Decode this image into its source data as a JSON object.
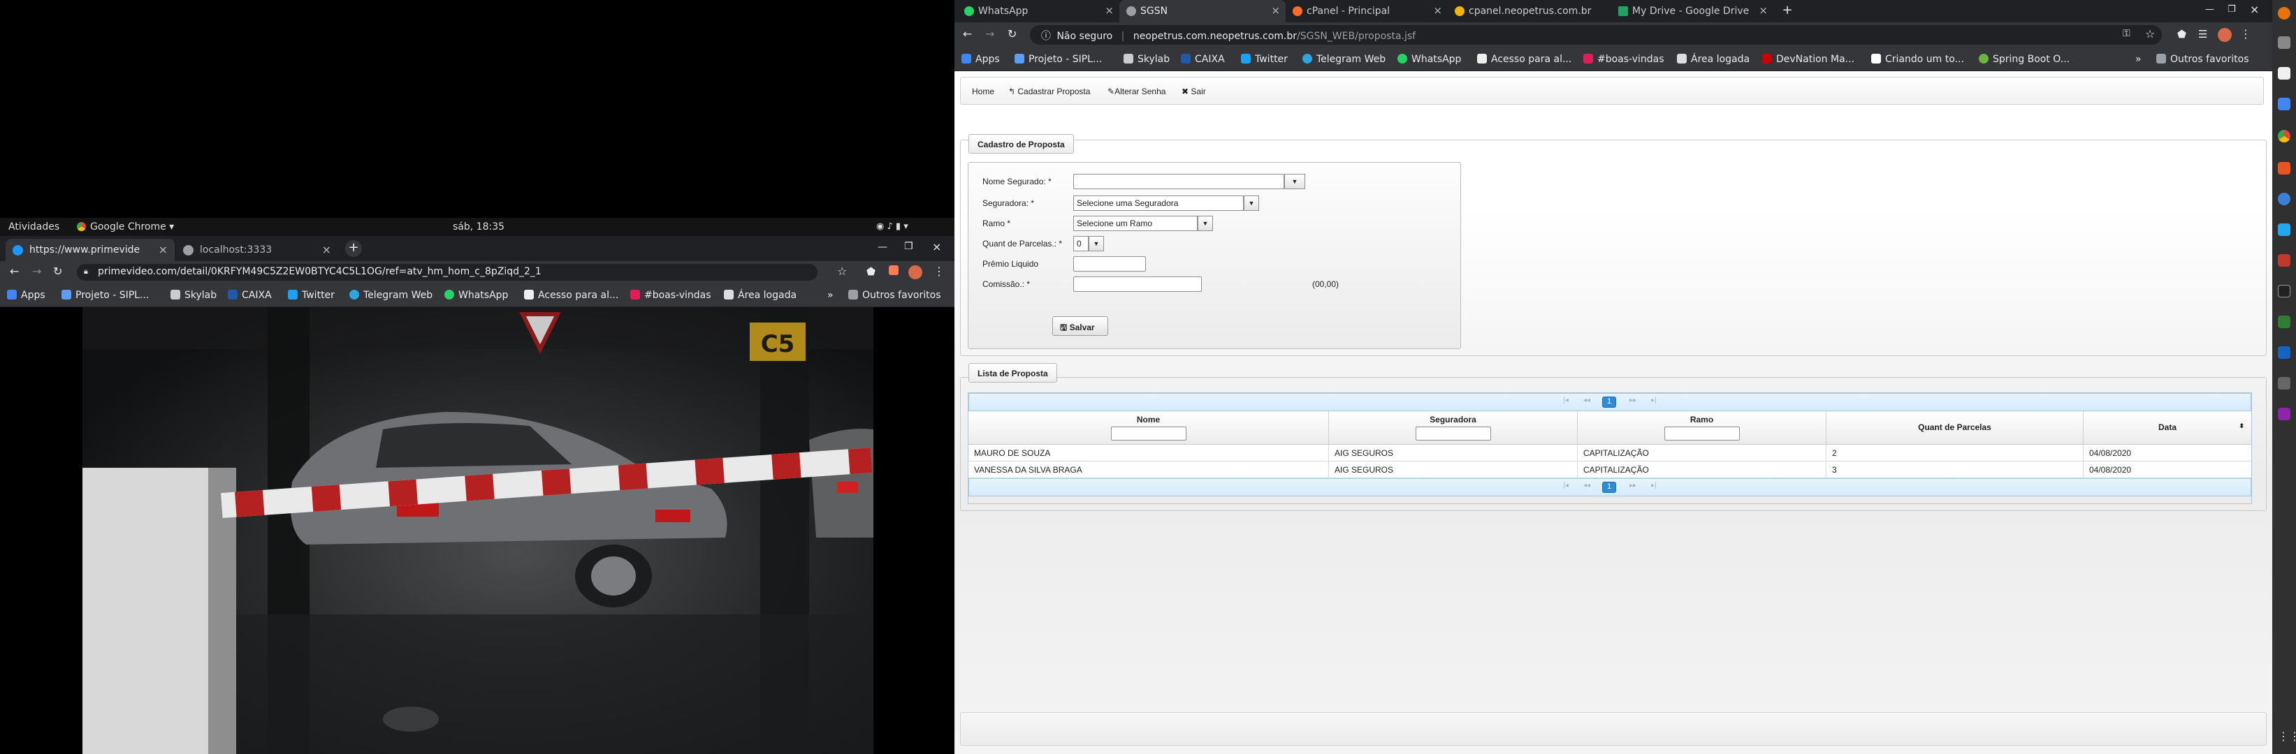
{
  "left_window": {
    "gnome": {
      "activities": "Atividades",
      "app": "Google Chrome",
      "clock": "sáb, 18:35"
    },
    "tabs": [
      {
        "label": "https://www.primevide",
        "active": true
      },
      {
        "label": "localhost:3333",
        "active": false
      }
    ],
    "url": "primevideo.com/detail/0KRFYM49C5Z2EW0BTYC4C5L1OG/ref=atv_hm_hom_c_8pZiqd_2_1",
    "bookmarks": [
      "Apps",
      "Projeto - SIPL...",
      "Skylab",
      "CAIXA",
      "Twitter",
      "Telegram Web",
      "WhatsApp",
      "Acesso para al...",
      "#boas-vindas",
      "Área logada"
    ],
    "other_bookmarks": "Outros favoritos",
    "video_sign": "C5"
  },
  "right_window": {
    "tabs": [
      {
        "label": "WhatsApp",
        "active": false,
        "color": "#25d366"
      },
      {
        "label": "SGSN",
        "active": true,
        "color": "#9aa0a6"
      },
      {
        "label": "cPanel - Principal",
        "active": false,
        "color": "#ff6c2c"
      },
      {
        "label": "cpanel.neopetrus.com.br",
        "active": false,
        "color": "#f4b400"
      },
      {
        "label": "My Drive - Google Drive",
        "active": false,
        "color": "#1fa463"
      }
    ],
    "security": "Não seguro",
    "url_domain": "neopetrus.com.neopetrus.com.br",
    "url_path": "/SGSN_WEB/proposta.jsf",
    "bookmarks": [
      "Apps",
      "Projeto - SIPL...",
      "Skylab",
      "CAIXA",
      "Twitter",
      "Telegram Web",
      "WhatsApp",
      "Acesso para al...",
      "#boas-vindas",
      "Área logada",
      "DevNation Ma...",
      "Criando um to...",
      "Spring Boot O..."
    ],
    "other_bookmarks": "Outros favoritos"
  },
  "page": {
    "menu": {
      "home": "Home",
      "cadastrar": "Cadastrar Proposta",
      "alterar": "Alterar Senha",
      "sair": "Sair"
    },
    "form": {
      "legend": "Cadastro de Proposta",
      "nome_label": "Nome Segurado: *",
      "seguradora_label": "Seguradora: *",
      "seguradora_value": "Selecione uma Seguradora",
      "ramo_label": "Ramo *",
      "ramo_value": "Selecione um Ramo",
      "parcelas_label": "Quant de Parcelas.: *",
      "parcelas_value": "0",
      "premio_label": "Prêmio Liquido",
      "comissao_label": "Comissão.: *",
      "comissao_hint": "(00,00)",
      "save_label": "Salvar"
    },
    "list": {
      "legend": "Lista de Proposta",
      "current_page": "1",
      "headers": [
        "Nome",
        "Seguradora",
        "Ramo",
        "Quant de Parcelas",
        "Data"
      ],
      "rows": [
        [
          "MAURO DE SOUZA",
          "AIG SEGUROS",
          "CAPITALIZAÇÃO",
          "2",
          "04/08/2020"
        ],
        [
          "VANESSA DA SILVA BRAGA",
          "AIG SEGUROS",
          "CAPITALIZAÇÃO",
          "3",
          "04/08/2020"
        ]
      ]
    }
  }
}
